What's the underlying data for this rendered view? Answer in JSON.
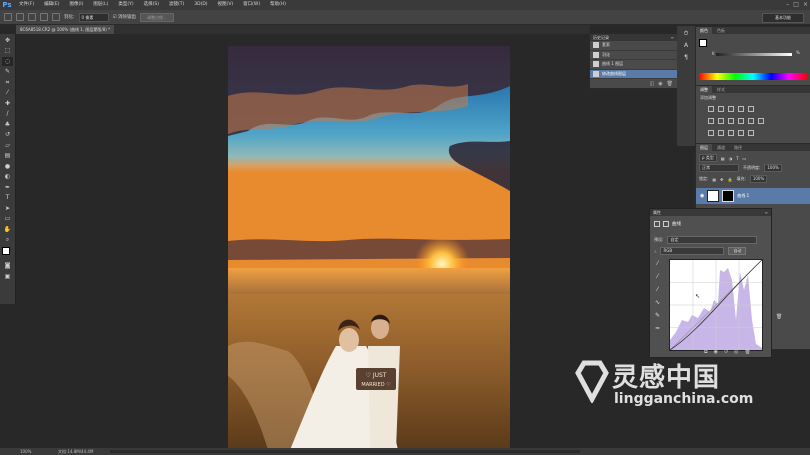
{
  "app": {
    "logo": "Ps"
  },
  "menubar": {
    "items": [
      "文件(F)",
      "编辑(E)",
      "图像(I)",
      "图层(L)",
      "类型(Y)",
      "选择(S)",
      "滤镜(T)",
      "3D(D)",
      "视图(V)",
      "窗口(W)",
      "帮助(H)"
    ]
  },
  "options": {
    "feather_label": "羽化:",
    "feather_value": "0 像素",
    "antialias_label": "消除锯齿",
    "refine_edge_label": "调整边缘...",
    "workspace": "基本功能"
  },
  "document": {
    "tab_title": "8C6A8518.CR2 @ 100% (曲线 1, 图层蒙版/8) *"
  },
  "history": {
    "title": "历史记录",
    "items": [
      {
        "label": "套索",
        "selected": false
      },
      {
        "label": "羽化",
        "selected": false
      },
      {
        "label": "曲线 1 图层",
        "selected": false
      },
      {
        "label": "修改曲线图层",
        "selected": true
      }
    ]
  },
  "color_panel": {
    "tabs": [
      "颜色",
      "色板"
    ],
    "channel": "K",
    "value": "%"
  },
  "adjustments": {
    "tabs": [
      "调整",
      "样式"
    ],
    "title": "添加调整"
  },
  "layers": {
    "tabs": [
      "图层",
      "通道",
      "路径"
    ],
    "filter": "类型",
    "blend_mode": "正常",
    "opacity_label": "不透明度:",
    "opacity": "100%",
    "lock_label": "锁定:",
    "fill_label": "填充:",
    "fill": "100%",
    "selected_layer": "曲线 1"
  },
  "properties": {
    "title": "属性",
    "adjustment": "曲线",
    "preset_label": "预设:",
    "preset": "自定",
    "channel": "RGB",
    "auto": "自动"
  },
  "status": {
    "zoom": "100%",
    "doc": "文档:14.8M/44.4M"
  },
  "watermark": {
    "cn": "灵感中国",
    "url": "lingganchina.com"
  },
  "colors": {
    "selection": "#5a7ba8",
    "ps_blue": "#5aa8ff"
  }
}
